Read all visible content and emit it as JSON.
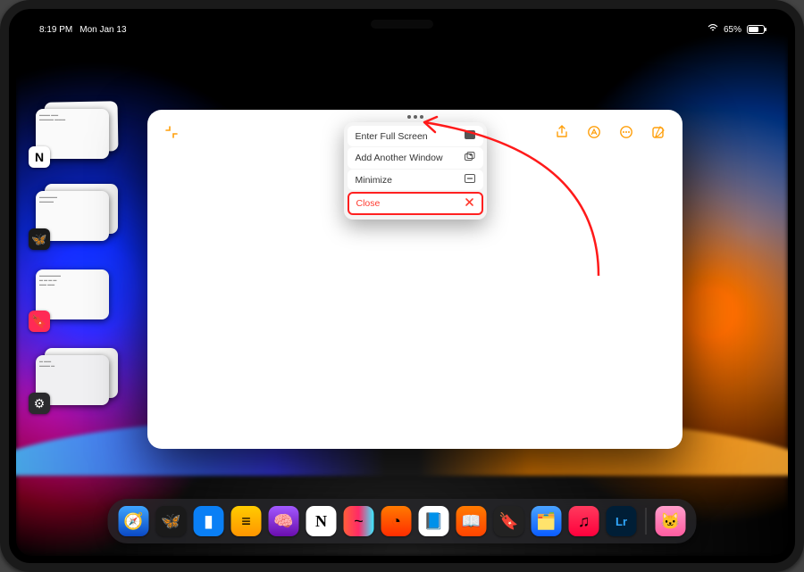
{
  "status": {
    "time": "8:19 PM",
    "date": "Mon Jan 13",
    "battery_pct": "65%"
  },
  "menu": {
    "fullscreen": "Enter Full Screen",
    "add_window": "Add Another Window",
    "minimize": "Minimize",
    "close": "Close"
  },
  "stage": {
    "pile1_icon": "notion-icon",
    "pile2_icon": "butterfly-icon",
    "pile3_icon": "bookmark-icon",
    "pile4_icon": "settings-icon"
  },
  "dock": {
    "items": [
      {
        "name": "safari-icon",
        "bg": "linear-gradient(#3ea5ff,#0a48c4)",
        "glyph": "🧭"
      },
      {
        "name": "butterfly-app-icon",
        "bg": "#1a1a1a",
        "glyph": "🦋"
      },
      {
        "name": "bluesky-icon",
        "bg": "#0a7ff5",
        "glyph": "▮"
      },
      {
        "name": "bear-icon",
        "bg": "linear-gradient(#ffcc00,#ff9500)",
        "glyph": "≡"
      },
      {
        "name": "brain-app-icon",
        "bg": "linear-gradient(#a259ff,#6a0dad)",
        "glyph": "🧠"
      },
      {
        "name": "notion-icon",
        "bg": "#fff",
        "glyph": "N"
      },
      {
        "name": "craft-icon",
        "bg": "linear-gradient(90deg,#ff5e3a,#ff2a68,#3aeaff)",
        "glyph": "~"
      },
      {
        "name": "brave-icon",
        "bg": "linear-gradient(#ff7a00,#ff2d00)",
        "glyph": "◔"
      },
      {
        "name": "scan-app-icon",
        "bg": "#fff",
        "glyph": "📘"
      },
      {
        "name": "books-icon",
        "bg": "linear-gradient(#ff7a00,#ff4400)",
        "glyph": "📖"
      },
      {
        "name": "bookmark-app-icon",
        "bg": "#222",
        "glyph": "🔖"
      },
      {
        "name": "files-icon",
        "bg": "linear-gradient(#4aa3ff,#0a5cff)",
        "glyph": "🗂️"
      },
      {
        "name": "music-icon",
        "bg": "linear-gradient(#ff3a5e,#ff003c)",
        "glyph": "♫"
      },
      {
        "name": "lightroom-icon",
        "bg": "#001e36",
        "glyph": "Lr"
      },
      {
        "name": "pet-app-icon",
        "bg": "linear-gradient(#ff9ecb,#ff5ca0)",
        "glyph": "🐱"
      }
    ]
  },
  "colors": {
    "accent": "#ff9f0a",
    "destructive": "#ff3b30"
  }
}
